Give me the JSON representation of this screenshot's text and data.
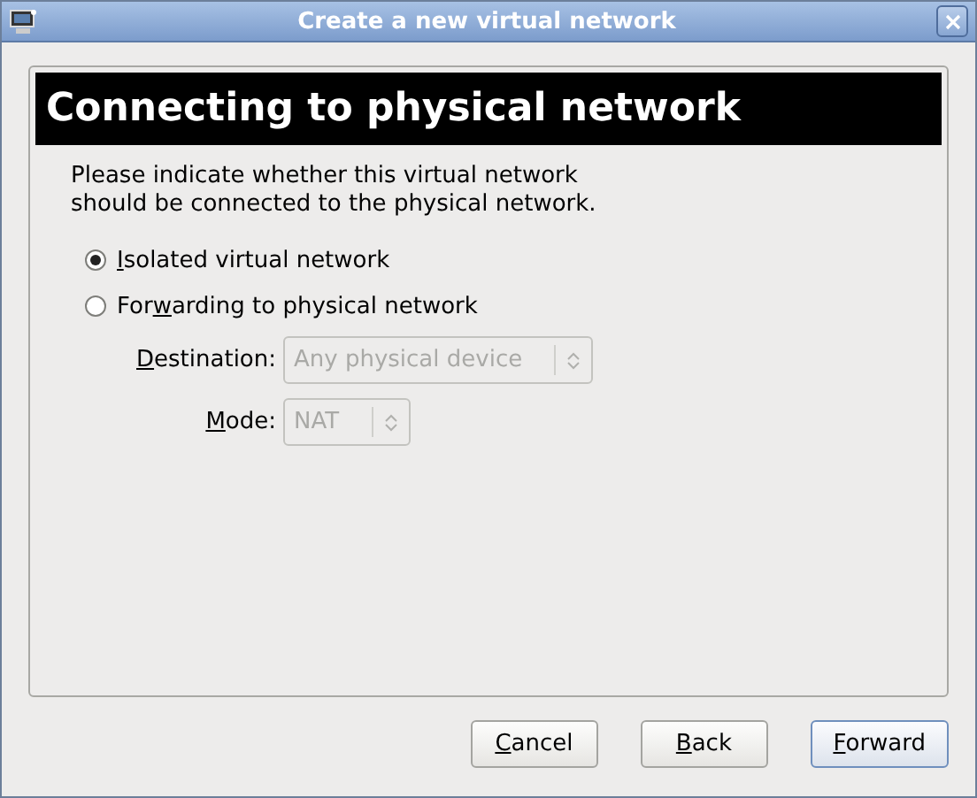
{
  "window": {
    "title": "Create a new virtual network"
  },
  "header": {
    "title": "Connecting to physical network"
  },
  "description": "Please indicate whether this virtual network should be connected to the physical network.",
  "options": [
    {
      "mnemonic": "I",
      "after": "solated virtual network",
      "selected": true
    },
    {
      "before": "For",
      "mnemonic": "w",
      "after": "arding to physical network",
      "selected": false
    }
  ],
  "fields": [
    {
      "mnemonic": "D",
      "after": "estination:",
      "value": "Any physical device",
      "disabled": true
    },
    {
      "mnemonic": "M",
      "after": "ode:",
      "value": "NAT",
      "disabled": true
    }
  ],
  "buttons": [
    {
      "mnemonic": "C",
      "after": "ancel",
      "default": false
    },
    {
      "mnemonic": "B",
      "after": "ack",
      "default": false
    },
    {
      "mnemonic": "F",
      "after": "orward",
      "default": true
    }
  ]
}
